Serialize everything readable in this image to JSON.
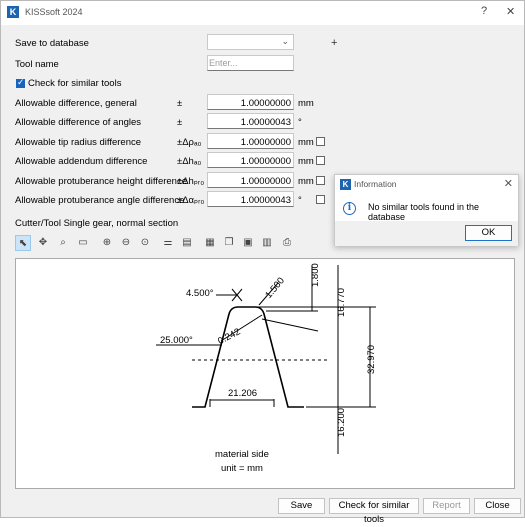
{
  "window": {
    "app_icon_letter": "K",
    "title": "KISSsoft 2024",
    "help_glyph": "?",
    "close_glyph": "✕"
  },
  "form": {
    "save_to_database_label": "Save to database",
    "save_to_database_value": "",
    "tool_name_label": "Tool name",
    "tool_name_placeholder": "Enter...",
    "check_similar_label": "Check for similar tools",
    "check_similar_checked": true,
    "rows": [
      {
        "label": "Allowable difference, general",
        "symbol": "±",
        "value": "1.00000000",
        "unit": "mm",
        "has_checkbox": false
      },
      {
        "label": "Allowable difference of angles",
        "symbol": "±",
        "value": "1.00000043",
        "unit": "°",
        "has_checkbox": false
      },
      {
        "label": "Allowable tip radius difference",
        "symbol": "±Δρₐ₀",
        "value": "1.00000000",
        "unit": "mm",
        "has_checkbox": true
      },
      {
        "label": "Allowable addendum difference",
        "symbol": "±Δhₐ₀",
        "value": "1.00000000",
        "unit": "mm",
        "has_checkbox": true
      },
      {
        "label": "Allowable protuberance height difference",
        "symbol": "±Δhₚᵣ₀",
        "value": "1.00000000",
        "unit": "mm",
        "has_checkbox": true
      },
      {
        "label": "Allowable protuberance angle difference",
        "symbol": "±Δαₚᵣ₀",
        "value": "1.00000043",
        "unit": "°",
        "has_checkbox": true
      }
    ]
  },
  "graphic": {
    "section_title": "Cutter/Tool Single gear, normal section",
    "tools": [
      "select-icon",
      "move-icon",
      "zoom-window-icon",
      "measure-icon",
      "zoom-in-icon",
      "zoom-out-icon",
      "zoom-fit-icon",
      "settings-icon",
      "properties-icon",
      "report-icon",
      "copy-icon",
      "save-icon",
      "save-as-icon",
      "print-icon"
    ],
    "dim_angle_tip": "4.500°",
    "dim_tip_radius": "1.500",
    "dim_top_height": "1.800",
    "dim_addendum": "16.770",
    "dim_flank_angle": "25.000°",
    "dim_small": "0.242",
    "dim_total": "32.970",
    "dim_width": "21.206",
    "dim_dedendum": "16.200",
    "material_side": "material side",
    "unit_note": "unit = mm"
  },
  "buttons": {
    "save": "Save",
    "check_similar": "Check for similar tools",
    "report": "Report",
    "close": "Close"
  },
  "dialog": {
    "icon_letter": "K",
    "title": "Information",
    "close_glyph": "✕",
    "info_glyph": "i",
    "message": "No similar tools found in the database",
    "ok": "OK"
  },
  "colors": {
    "accent": "#1764c0",
    "disabled_text": "#9a9a9a"
  }
}
